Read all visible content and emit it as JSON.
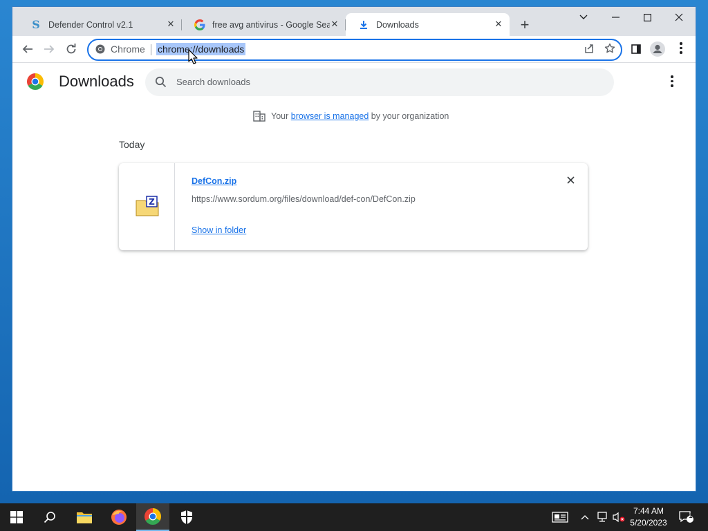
{
  "tabs": [
    {
      "title": "Defender Control v2.1",
      "icon": "sordum-icon",
      "active": false
    },
    {
      "title": "free avg antivirus - Google Searc",
      "icon": "google-icon",
      "active": false
    },
    {
      "title": "Downloads",
      "icon": "download-icon",
      "active": true
    }
  ],
  "omnibox": {
    "site_label": "Chrome",
    "url": "chrome://downloads"
  },
  "page": {
    "title": "Downloads",
    "search_placeholder": "Search downloads",
    "managed": {
      "prefix": "Your",
      "link": "browser is managed",
      "suffix": "by your organization"
    },
    "section": "Today",
    "downloads": [
      {
        "filename": "DefCon.zip",
        "url": "https://www.sordum.org/files/download/def-con/DefCon.zip",
        "action": "Show in folder"
      }
    ]
  },
  "taskbar": {
    "apps": [
      "start-icon",
      "search-icon",
      "file-explorer-icon",
      "firefox-icon",
      "chrome-icon",
      "defender-icon"
    ],
    "active_app": "chrome-icon",
    "notification_count": "1"
  },
  "clock": {
    "time": "7:44 AM",
    "date": "5/20/2023"
  },
  "colors": {
    "accent": "#1a73e8",
    "selection": "#a8c7fa",
    "tabstrip": "#dee1e6",
    "taskbar": "#1f1f1f"
  }
}
